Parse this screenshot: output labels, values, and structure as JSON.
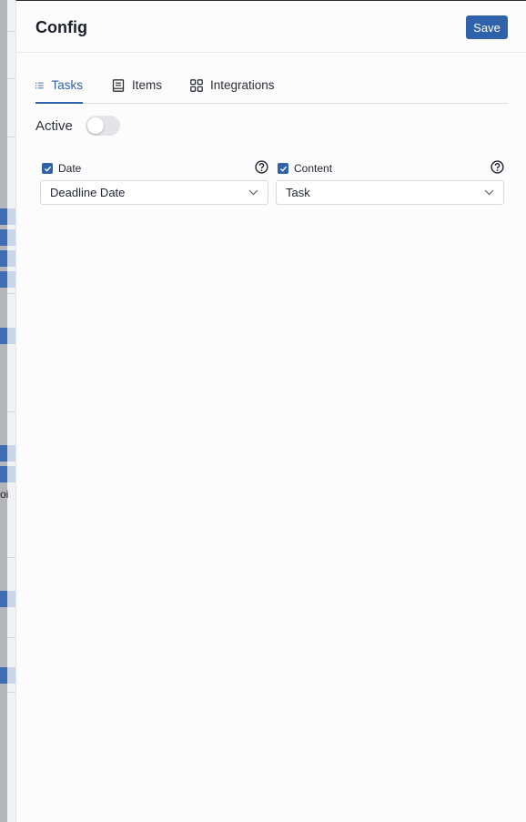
{
  "panel": {
    "title": "Config",
    "save_label": "Save"
  },
  "tabs": [
    {
      "label": "Tasks",
      "icon": "list-icon",
      "active": true
    },
    {
      "label": "Items",
      "icon": "document-icon",
      "active": false
    },
    {
      "label": "Integrations",
      "icon": "grid-icon",
      "active": false
    }
  ],
  "active": {
    "label": "Active",
    "enabled": false
  },
  "fields": {
    "date": {
      "checked": true,
      "label": "Date",
      "value": "Deadline Date"
    },
    "content": {
      "checked": true,
      "label": "Content",
      "value": "Task"
    }
  },
  "background": {
    "clipped_text": "oi"
  },
  "colors": {
    "accent": "#2f62aa",
    "panel_bg": "#fcfcfd",
    "toggle_off": "#e3e4e7"
  }
}
